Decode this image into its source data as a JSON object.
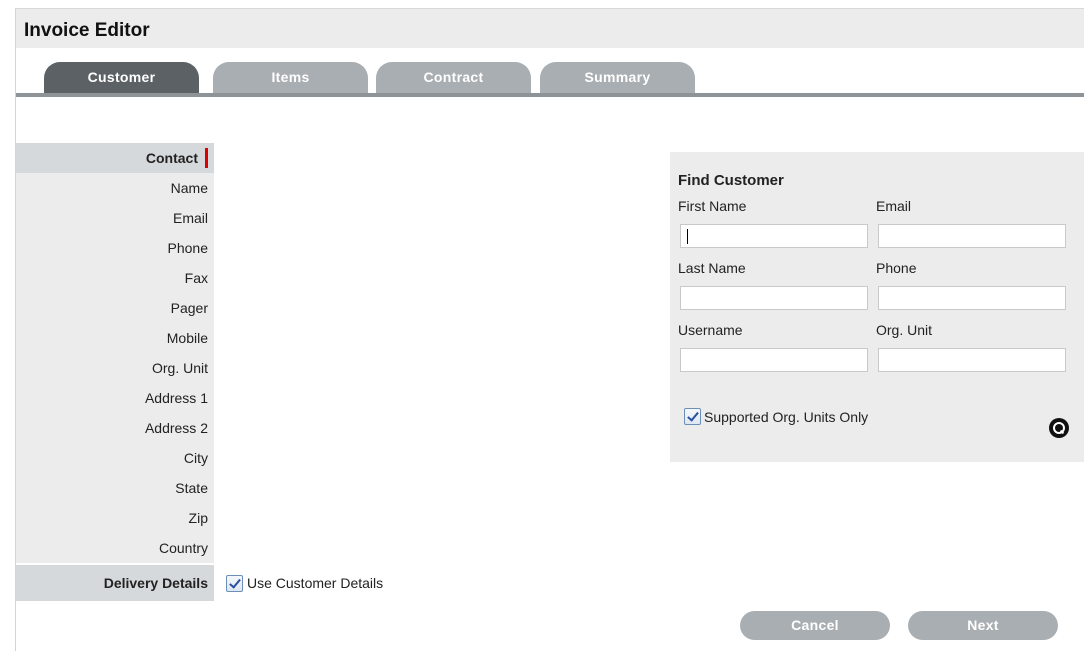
{
  "title": "Invoice Editor",
  "tabs": [
    {
      "label": "Customer",
      "active": true
    },
    {
      "label": "Items",
      "active": false
    },
    {
      "label": "Contract",
      "active": false
    },
    {
      "label": "Summary",
      "active": false
    }
  ],
  "contact": {
    "header": "Contact",
    "fields": [
      "Name",
      "Email",
      "Phone",
      "Fax",
      "Pager",
      "Mobile",
      "Org. Unit",
      "Address 1",
      "Address 2",
      "City",
      "State",
      "Zip",
      "Country"
    ]
  },
  "delivery": {
    "header": "Delivery Details",
    "use_customer_label": "Use Customer Details",
    "use_customer_checked": true
  },
  "find_customer": {
    "title": "Find Customer",
    "first_name_label": "First Name",
    "email_label": "Email",
    "last_name_label": "Last Name",
    "phone_label": "Phone",
    "username_label": "Username",
    "org_unit_label": "Org. Unit",
    "first_name_value": "",
    "email_value": "",
    "last_name_value": "",
    "phone_value": "",
    "username_value": "",
    "org_unit_value": "",
    "supported_label": "Supported Org. Units Only",
    "supported_checked": true
  },
  "buttons": {
    "cancel": "Cancel",
    "next": "Next"
  },
  "colors": {
    "tab_active": "#5c6166",
    "tab_inactive": "#a9aeb2",
    "required_marker": "#dd0000"
  }
}
